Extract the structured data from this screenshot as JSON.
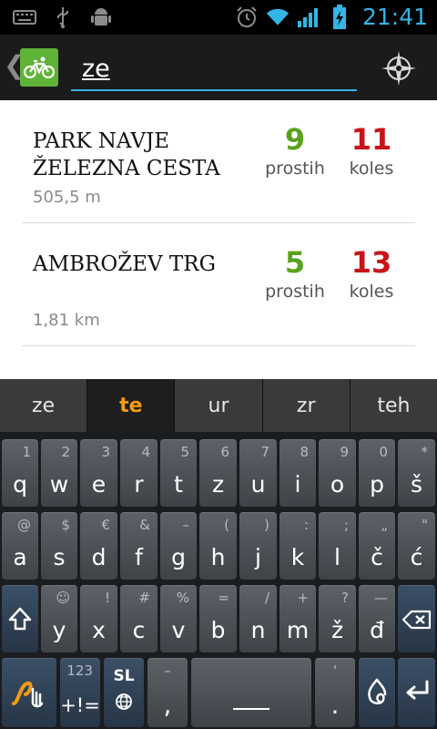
{
  "status_bar": {
    "time": "21:41",
    "left_icons": [
      "keyboard-icon",
      "usb-icon",
      "android-debug-icon"
    ],
    "right_icons": [
      "alarm-icon",
      "wifi-icon",
      "signal-icon",
      "battery-charging-icon"
    ]
  },
  "action_bar": {
    "back_glyph": "❮",
    "logo_icon": "bicycle-icon",
    "search": {
      "value": "ze",
      "placeholder": ""
    },
    "locate_icon": "compass-icon"
  },
  "stations": [
    {
      "name": "PARK NAVJE ŽELEZNA CESTA",
      "distance": "505,5 m",
      "free": "9",
      "free_label": "prostih",
      "bikes": "11",
      "bikes_label": "koles"
    },
    {
      "name": "AMBROŽEV TRG",
      "distance": "1,81 km",
      "free": "5",
      "free_label": "prostih",
      "bikes": "13",
      "bikes_label": "koles"
    }
  ],
  "suggestions": [
    "ze",
    "te",
    "ur",
    "zr",
    "teh"
  ],
  "keyboard": {
    "row1": [
      {
        "main": "q",
        "alt": "1"
      },
      {
        "main": "w",
        "alt": "2"
      },
      {
        "main": "e",
        "alt": "3"
      },
      {
        "main": "r",
        "alt": "4"
      },
      {
        "main": "t",
        "alt": "5"
      },
      {
        "main": "z",
        "alt": "6"
      },
      {
        "main": "u",
        "alt": "7"
      },
      {
        "main": "i",
        "alt": "8"
      },
      {
        "main": "o",
        "alt": "9"
      },
      {
        "main": "p",
        "alt": "0"
      },
      {
        "main": "š",
        "alt": "*"
      }
    ],
    "row2": [
      {
        "main": "a",
        "alt": "@"
      },
      {
        "main": "s",
        "alt": "$"
      },
      {
        "main": "d",
        "alt": "€"
      },
      {
        "main": "f",
        "alt": "&"
      },
      {
        "main": "g",
        "alt": "–"
      },
      {
        "main": "h",
        "alt": "("
      },
      {
        "main": "j",
        "alt": ")"
      },
      {
        "main": "k",
        "alt": ":"
      },
      {
        "main": "l",
        "alt": ";"
      },
      {
        "main": "č",
        "alt": "„"
      },
      {
        "main": "ć",
        "alt": "\""
      }
    ],
    "row3": [
      {
        "main": "y",
        "alt": "☺"
      },
      {
        "main": "x",
        "alt": "!"
      },
      {
        "main": "c",
        "alt": "#"
      },
      {
        "main": "v",
        "alt": "%"
      },
      {
        "main": "b",
        "alt": "="
      },
      {
        "main": "n",
        "alt": "/"
      },
      {
        "main": "m",
        "alt": "+"
      },
      {
        "main": "ž",
        "alt": "?"
      },
      {
        "main": "đ",
        "alt": "—"
      }
    ],
    "symbols_key": {
      "main": "+!=",
      "alt": "123"
    },
    "lang_key": {
      "main": "SL"
    },
    "comma_key": {
      "main": ",",
      "alt": "–"
    },
    "period_key": {
      "main": ".",
      "alt": "'"
    }
  }
}
